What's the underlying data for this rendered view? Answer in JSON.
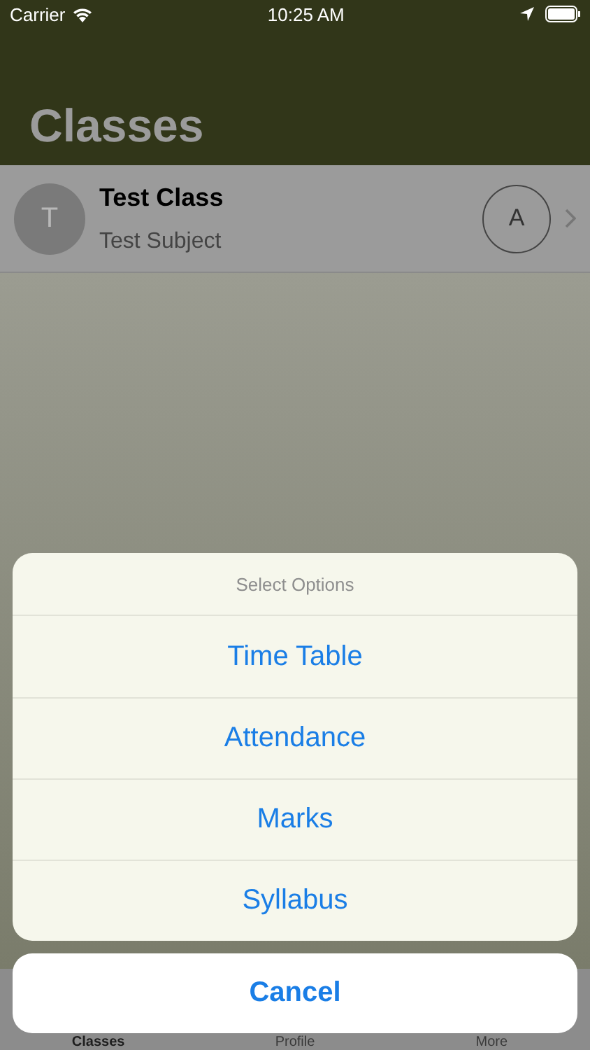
{
  "status_bar": {
    "carrier": "Carrier",
    "time": "10:25 AM"
  },
  "nav": {
    "title": "Classes"
  },
  "classes": [
    {
      "avatar": "T",
      "name": "Test Class",
      "subject": "Test Subject",
      "badge": "A"
    }
  ],
  "action_sheet": {
    "title": "Select Options",
    "actions": [
      "Time Table",
      "Attendance",
      "Marks",
      "Syllabus"
    ],
    "cancel": "Cancel"
  },
  "tab_bar": [
    {
      "label": "Classes",
      "selected": true
    },
    {
      "label": "Profile",
      "selected": false
    },
    {
      "label": "More",
      "selected": false
    }
  ]
}
